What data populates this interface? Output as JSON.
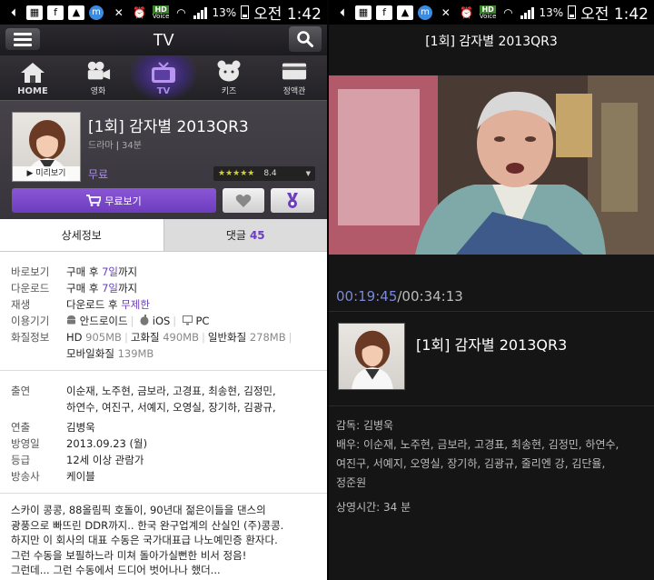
{
  "status_bar": {
    "hd_label": "HD",
    "voice_label": "Voice",
    "battery": "13%",
    "time": "오전 1:42"
  },
  "header": {
    "title": "TV"
  },
  "nav": {
    "items": [
      {
        "label": "HOME"
      },
      {
        "label": "영화"
      },
      {
        "label": "TV"
      },
      {
        "label": "키즈"
      },
      {
        "label": "정액관"
      }
    ]
  },
  "program": {
    "title": "[1회] 감자별 2013QR3",
    "genre": "드라마",
    "duration": "34분",
    "price": "무료",
    "rating_value": 8.4,
    "rating_text": "8.4",
    "stars_display": "★★★★★",
    "preview_label": "미리보기",
    "free_watch_label": "무료보기"
  },
  "tabs": {
    "details": "상세정보",
    "comments": "댓글",
    "comments_count": "45"
  },
  "details": {
    "direct_label": "바로보기",
    "direct_pre": "구매 후 ",
    "direct_days": "7일",
    "direct_post": "까지",
    "download_label": "다운로드",
    "download_pre": "구매 후 ",
    "download_days": "7일",
    "download_post": "까지",
    "replay_label": "재생",
    "replay_pre": "다운로드 후 ",
    "replay_value": "무제한",
    "device_label": "이용기기",
    "device_android": "안드로이드",
    "device_ios": "iOS",
    "device_pc": "PC",
    "quality_label": "화질정보",
    "hd_name": "HD",
    "hd_size": "905MB",
    "hq_name": "고화질",
    "hq_size": "490MB",
    "sd_name": "일반화질",
    "sd_size": "278MB",
    "mobile_name": "모바일화질",
    "mobile_size": "139MB"
  },
  "credits": {
    "cast_label": "출연",
    "cast_line1": "이순재, 노주현, 금보라, 고경표, 최송현, 김정민,",
    "cast_line2": "하연수, 여진구, 서예지, 오영실, 장기하, 김광규,",
    "director_label": "연출",
    "director": "김병욱",
    "airdate_label": "방영일",
    "airdate": "2013.09.23 (월)",
    "grade_label": "등급",
    "grade": "12세 이상 관람가",
    "broadcaster_label": "방송사",
    "broadcaster": "케이블"
  },
  "description": {
    "line1": "스카이 콩콩, 88올림픽 호돌이, 90년대 젊은이들을 댄스의",
    "line2": "광풍으로 빠뜨린 DDR까지.. 한국 완구업계의 산실인 (주)콩콩.",
    "line3": "하지만 이 회사의 대표 수동은 국가대표급 나노예민증 환자다.",
    "line4": "그런 수동을 보필하느라 미쳐 돌아가실뻔한 비서 정음!",
    "line5": "그런데... 그런 수동에서 드디어 벗어나나 했더..."
  },
  "player": {
    "title": "[1회] 감자별 2013QR3",
    "current_time": "00:19:45",
    "total_time": "/00:34:13",
    "episode_title": "[1회] 감자별 2013QR3",
    "director_line": "감독: 김병욱",
    "cast_line1": "배우: 이순재, 노주현, 금보라, 고경표, 최송현, 김정민, 하연수,",
    "cast_line2": "여진구, 서예지, 오영실, 장기하, 김광규, 줄리엔 강, 김단율,",
    "cast_line3": "정준원",
    "runtime_line": "상영시간: 34 분"
  }
}
